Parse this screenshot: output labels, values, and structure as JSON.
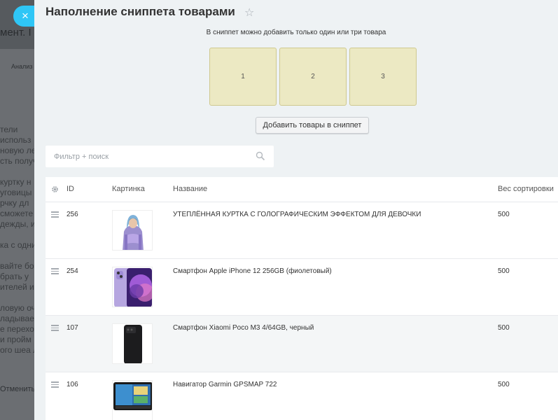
{
  "background": {
    "title": "мент. I",
    "tab": "Анализ",
    "lines": [
      "тели",
      "использ",
      "новую ле",
      "сть получ",
      "",
      "куртку н",
      "уговицы",
      "рчку дл",
      "сможете",
      "дежды, и",
      "",
      "ка с одни",
      "",
      "вайте бо",
      "брать у",
      "ителей и",
      "",
      "ловую оч",
      "ладывае",
      "е перехо",
      "и пройм",
      "ого шеа л"
    ],
    "bottom_text": "Отменить"
  },
  "close_button": {
    "icon": "close-icon",
    "label": "×"
  },
  "panel": {
    "title": "Наполнение сниппета товарами",
    "star_icon": "star-icon",
    "hint": "В сниппет можно добавить только один или три товара",
    "slots": [
      "1",
      "2",
      "3"
    ],
    "add_button": "Добавить товары в сниппет",
    "search": {
      "placeholder": "Фильтр + поиск",
      "value": ""
    }
  },
  "table": {
    "columns": {
      "id": "ID",
      "picture": "Картинка",
      "name": "Название",
      "sort": "Вес сортировки"
    },
    "rows": [
      {
        "id": "256",
        "picture": "girl-jacket-image",
        "name": "УТЕПЛЁННАЯ КУРТКА С ГОЛОГРАФИЧЕСКИМ ЭФФЕКТОМ ДЛЯ ДЕВОЧКИ",
        "sort": "500"
      },
      {
        "id": "254",
        "picture": "iphone-purple-image",
        "name": "Смартфон Apple iPhone 12 256GB (фиолетовый)",
        "sort": "500"
      },
      {
        "id": "107",
        "picture": "xiaomi-black-image",
        "name": "Смартфон Xiaomi Poco M3 4/64GB, черный",
        "sort": "500"
      },
      {
        "id": "106",
        "picture": "garmin-navigator-image",
        "name": "Навигатор Garmin GPSMAP 722",
        "sort": "500"
      }
    ]
  },
  "colors": {
    "accent": "#2fc6f6",
    "slot_bg": "#ece9c3",
    "panel_bg": "#eef2f4"
  }
}
